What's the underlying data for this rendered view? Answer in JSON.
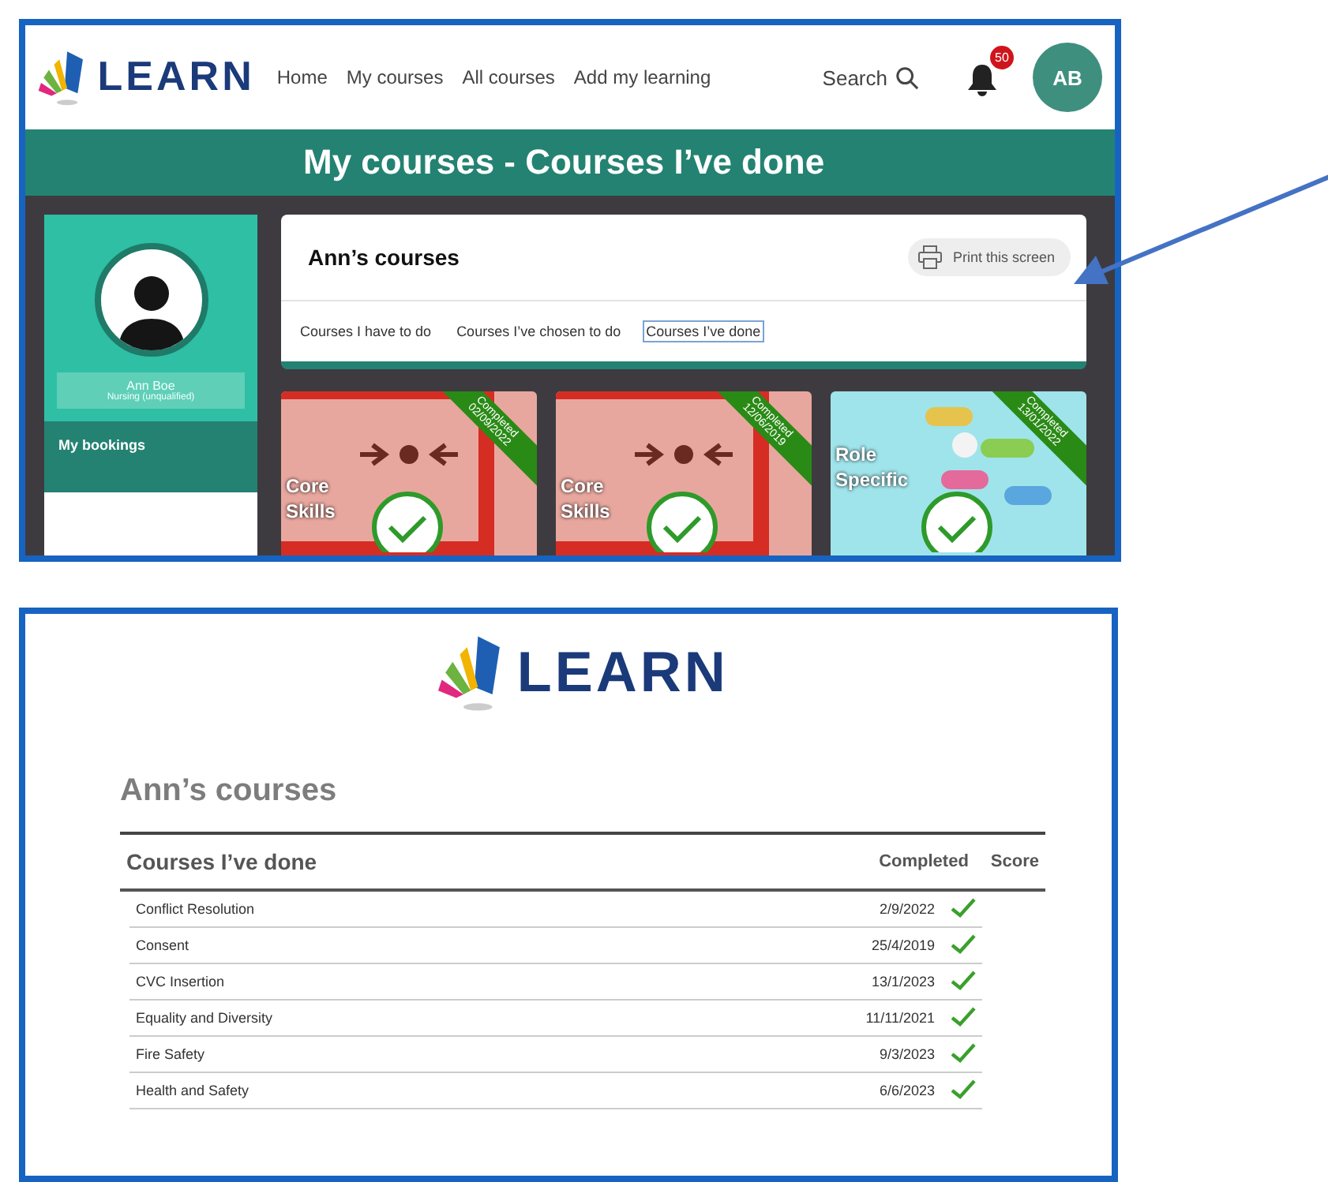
{
  "top_screen": {
    "logo": "LEARN",
    "nav": [
      "Home",
      "My courses",
      "All courses",
      "Add my learning"
    ],
    "search": "Search",
    "notifications": "50",
    "avatar": "AB",
    "banner": "My courses - Courses I’ve done",
    "profile": {
      "name": "Ann Boe",
      "role": "Nursing (unqualified)",
      "menu": [
        "My bookings"
      ]
    },
    "panel": {
      "title": "Ann’s courses",
      "print_button": "Print this screen",
      "tabs": [
        {
          "label": "Courses I have to do",
          "selected": false
        },
        {
          "label": "Courses I’ve chosen to do",
          "selected": false
        },
        {
          "label": "Courses I’ve done",
          "selected": true
        }
      ]
    },
    "cards": [
      {
        "kind": "alarm",
        "label": "Core Skills",
        "ribbon": "Completed",
        "date": "02/09/2022"
      },
      {
        "kind": "alarm",
        "label": "Core Skills",
        "ribbon": "Completed",
        "date": "12/06/2019"
      },
      {
        "kind": "pills",
        "label": "Role Specific",
        "ribbon": "Completed",
        "date": "13/01/2022"
      }
    ]
  },
  "print_screen": {
    "logo": "LEARN",
    "heading": "Ann’s courses",
    "table": {
      "columns": [
        "Courses I’ve done",
        "Completed",
        "Score"
      ],
      "rows": [
        {
          "course": "Conflict Resolution",
          "completed": "2/9/2022",
          "passed": true
        },
        {
          "course": "Consent",
          "completed": "25/4/2019",
          "passed": true
        },
        {
          "course": "CVC Insertion",
          "completed": "13/1/2023",
          "passed": true
        },
        {
          "course": "Equality and Diversity",
          "completed": "11/11/2021",
          "passed": true
        },
        {
          "course": "Fire Safety",
          "completed": "9/3/2023",
          "passed": true
        },
        {
          "course": "Health and Safety",
          "completed": "6/6/2023",
          "passed": true
        }
      ]
    }
  }
}
